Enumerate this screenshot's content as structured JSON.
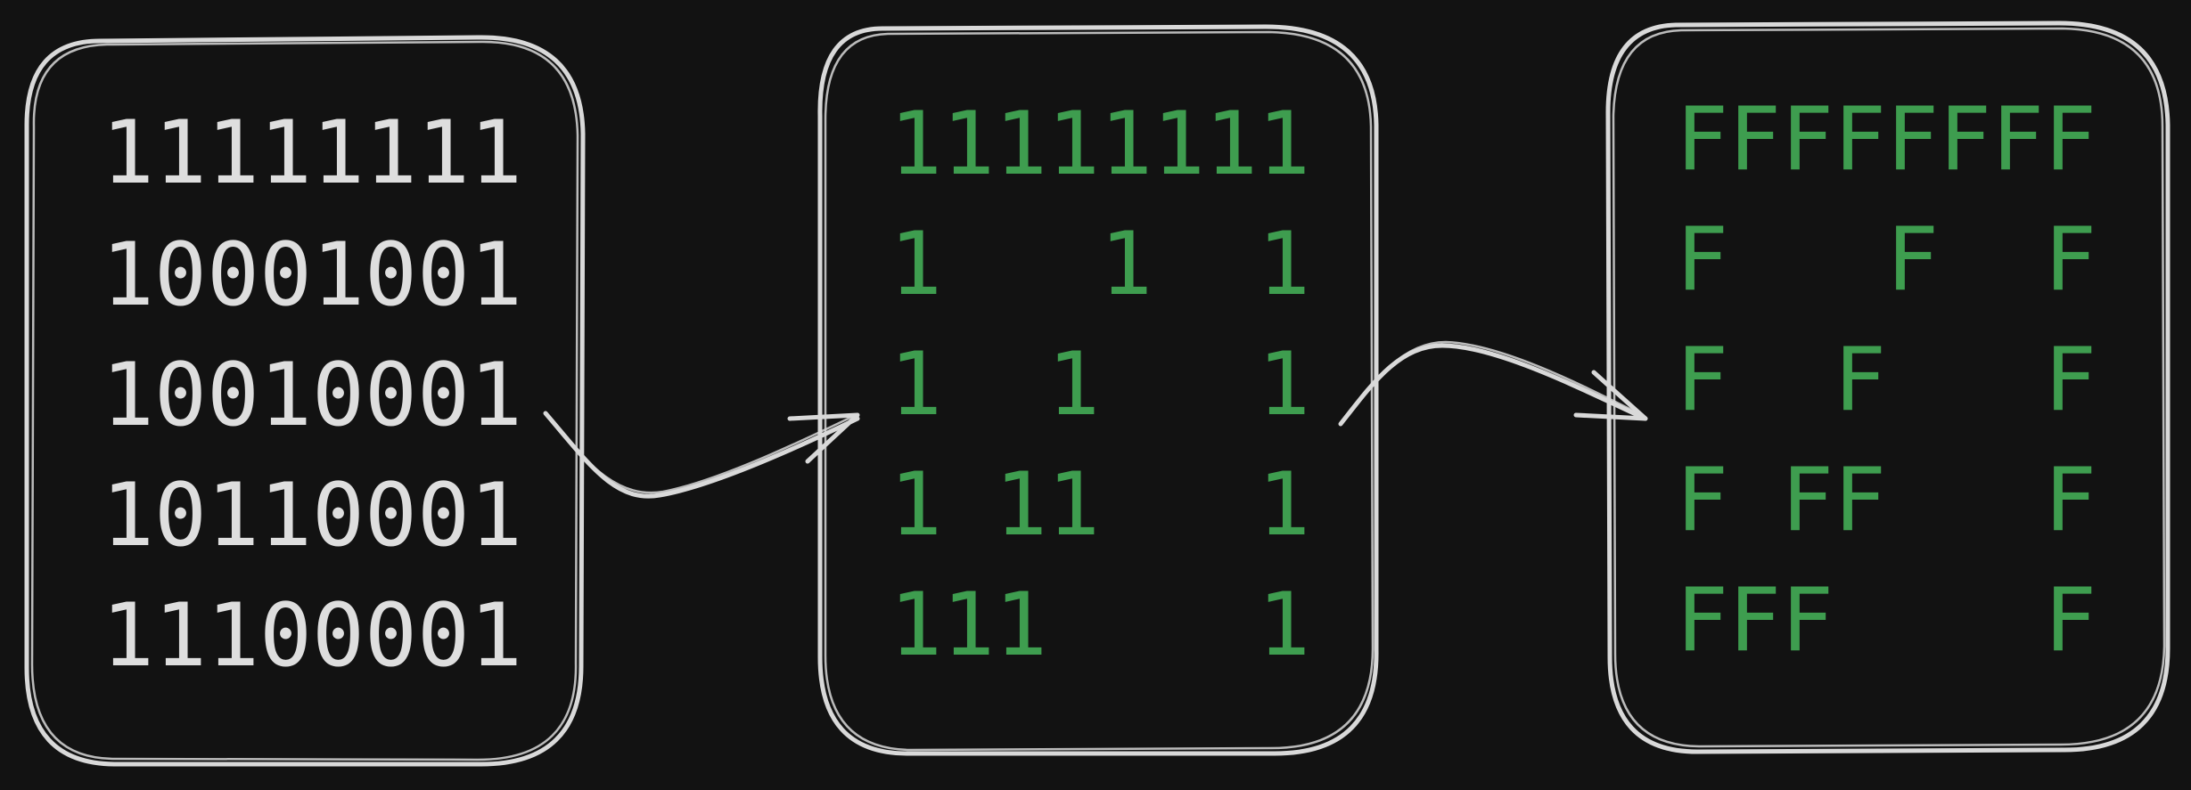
{
  "colors": {
    "background": "#121212",
    "outline": "#d9d9d9",
    "plain_text": "#dedede",
    "highlight_text": "#3e9d4f"
  },
  "panels": [
    {
      "name": "binary-panel",
      "rows": [
        "11111111",
        "10001001",
        "10010001",
        "10110001",
        "11100001"
      ]
    },
    {
      "name": "ones-panel",
      "rows": [
        "11111111",
        "1   1  1",
        "1  1   1",
        "1 11   1",
        "111    1"
      ]
    },
    {
      "name": "hex-panel",
      "rows": [
        "FFFFFFFF",
        "F   F  F",
        "F  F   F",
        "F FF   F",
        "FFF    F"
      ]
    }
  ],
  "arrows": [
    {
      "name": "arrow-binary-to-ones"
    },
    {
      "name": "arrow-ones-to-hex"
    }
  ]
}
